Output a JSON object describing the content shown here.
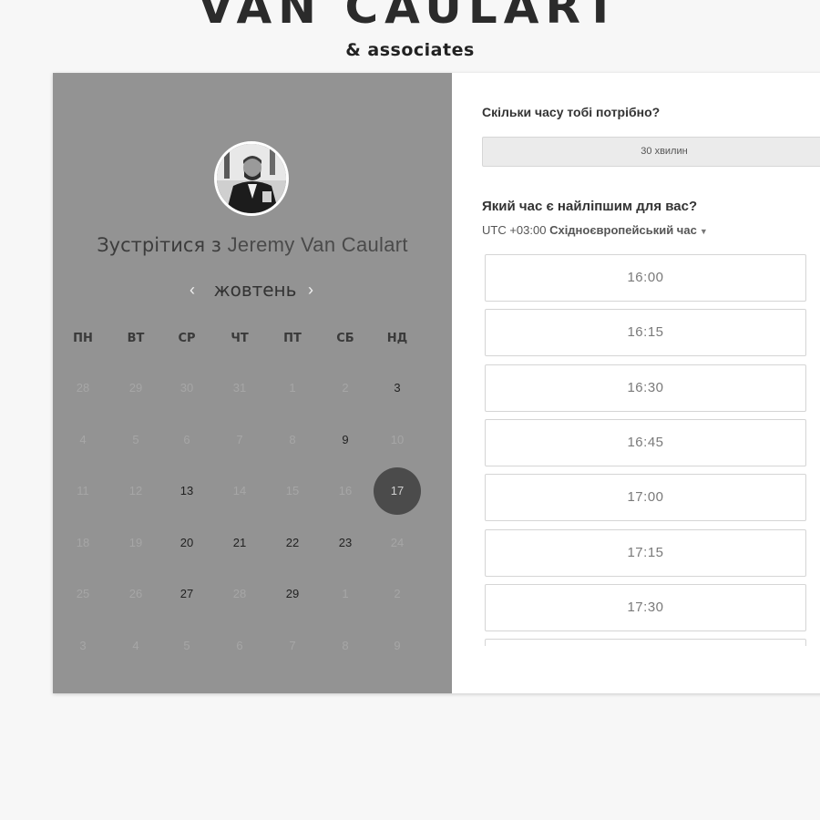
{
  "brand": {
    "title": "VAN CAULART",
    "subtitle": "& associates"
  },
  "host": {
    "prefix": "Зустрітися з ",
    "name": "Jeremy Van Caulart",
    "avatar_icon": "person-photo-icon"
  },
  "calendar": {
    "month": "жовтень",
    "prev_icon": "chevron-left-icon",
    "next_icon": "chevron-right-icon",
    "prev_glyph": "‹",
    "next_glyph": "›",
    "weekdays": [
      "пн",
      "вт",
      "ср",
      "чт",
      "пт",
      "сб",
      "нд"
    ],
    "weeks": [
      [
        {
          "d": "28",
          "s": "muted"
        },
        {
          "d": "29",
          "s": "muted"
        },
        {
          "d": "30",
          "s": "muted"
        },
        {
          "d": "31",
          "s": "muted"
        },
        {
          "d": "1",
          "s": "muted"
        },
        {
          "d": "2",
          "s": "muted"
        },
        {
          "d": "3",
          "s": "available"
        }
      ],
      [
        {
          "d": "4",
          "s": "muted"
        },
        {
          "d": "5",
          "s": "muted"
        },
        {
          "d": "6",
          "s": "muted"
        },
        {
          "d": "7",
          "s": "muted"
        },
        {
          "d": "8",
          "s": "muted"
        },
        {
          "d": "9",
          "s": "available"
        },
        {
          "d": "10",
          "s": "muted"
        }
      ],
      [
        {
          "d": "11",
          "s": "muted"
        },
        {
          "d": "12",
          "s": "muted"
        },
        {
          "d": "13",
          "s": "available"
        },
        {
          "d": "14",
          "s": "muted"
        },
        {
          "d": "15",
          "s": "muted"
        },
        {
          "d": "16",
          "s": "muted"
        },
        {
          "d": "17",
          "s": "selected"
        }
      ],
      [
        {
          "d": "18",
          "s": "muted"
        },
        {
          "d": "19",
          "s": "muted"
        },
        {
          "d": "20",
          "s": "available"
        },
        {
          "d": "21",
          "s": "available"
        },
        {
          "d": "22",
          "s": "available"
        },
        {
          "d": "23",
          "s": "available"
        },
        {
          "d": "24",
          "s": "muted"
        }
      ],
      [
        {
          "d": "25",
          "s": "muted"
        },
        {
          "d": "26",
          "s": "muted"
        },
        {
          "d": "27",
          "s": "available"
        },
        {
          "d": "28",
          "s": "muted"
        },
        {
          "d": "29",
          "s": "available"
        },
        {
          "d": "1",
          "s": "muted"
        },
        {
          "d": "2",
          "s": "muted"
        }
      ],
      [
        {
          "d": "3",
          "s": "muted"
        },
        {
          "d": "4",
          "s": "muted"
        },
        {
          "d": "5",
          "s": "muted"
        },
        {
          "d": "6",
          "s": "muted"
        },
        {
          "d": "7",
          "s": "muted"
        },
        {
          "d": "8",
          "s": "muted"
        },
        {
          "d": "9",
          "s": "muted"
        }
      ]
    ],
    "selected_day": "17"
  },
  "booking": {
    "duration_question": "Скільки часу тобі потрібно?",
    "duration_value": "30 хвилин",
    "time_question": "Який час є найліпшим для вас?",
    "tz_offset": "UTC +03:00 ",
    "tz_name": "Східноєвропейський час",
    "tz_caret_icon": "caret-down-icon",
    "tz_caret_glyph": "▼",
    "slots": [
      "16:00",
      "16:15",
      "16:30",
      "16:45",
      "17:00",
      "17:15",
      "17:30",
      ""
    ]
  },
  "colors": {
    "left_panel": "#939393",
    "selected_day": "#4b4b4b",
    "right_panel": "#ffffff",
    "page_bg": "#f7f7f7"
  }
}
